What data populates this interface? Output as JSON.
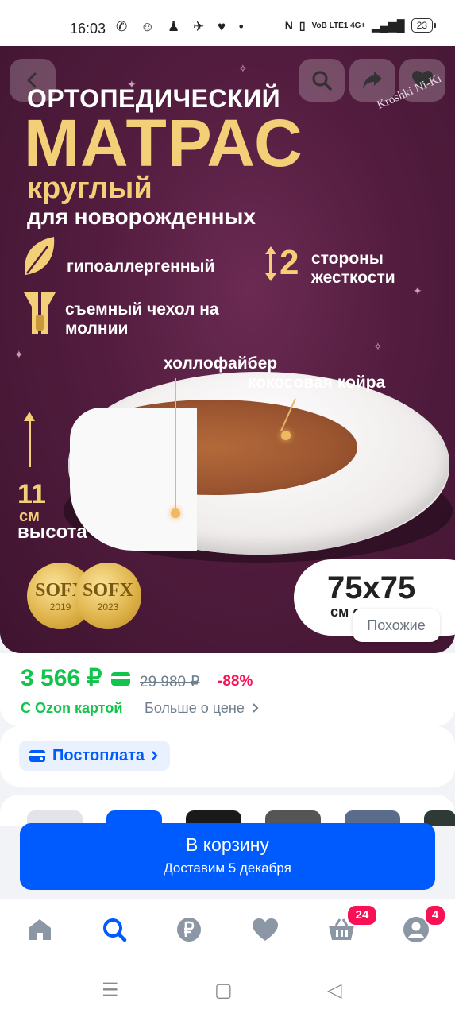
{
  "status_bar": {
    "time": "16:03",
    "network": "VoB LTE1 4G+",
    "battery": "23"
  },
  "hero": {
    "title_line1": "ОРТОПЕДИЧЕСКИЙ",
    "title_line2": "МАТРАС",
    "title_line3": "круглый",
    "title_line4": "для новорожденных",
    "brand": "Kroshki Ni-Ki",
    "feature_hypo": "гипоаллергенный",
    "feature_sides_num": "2",
    "feature_sides_text": "стороны жесткости",
    "feature_zip": "съемный чехол на молнии",
    "label_hollofiber": "холлофайбер",
    "label_coir": "кокосовая койра",
    "height_value": "11",
    "height_unit": "см",
    "height_label": "высота",
    "medal1_logo": "SOFX",
    "medal1_year": "2019",
    "medal2_logo": "SOFX",
    "medal2_year": "2023",
    "size": "75х75",
    "size_unit": "см см",
    "similar_button": "Похожие"
  },
  "price": {
    "current": "3 566 ₽",
    "old": "29 980 ₽",
    "discount": "-88%",
    "ozon_card": "С Ozon картой",
    "more_about_price": "Больше о цене"
  },
  "postpay": {
    "label": "Постоплата"
  },
  "cart": {
    "button_label": "В корзину",
    "delivery": "Доставим 5 декабря"
  },
  "bottom_nav": {
    "cart_badge": "24",
    "profile_badge": "4"
  },
  "colors": {
    "accent_blue": "#005bff",
    "price_green": "#10c44c",
    "discount_red": "#f91155",
    "hero_bg": "#521c3e",
    "gold": "#f3cf78"
  }
}
